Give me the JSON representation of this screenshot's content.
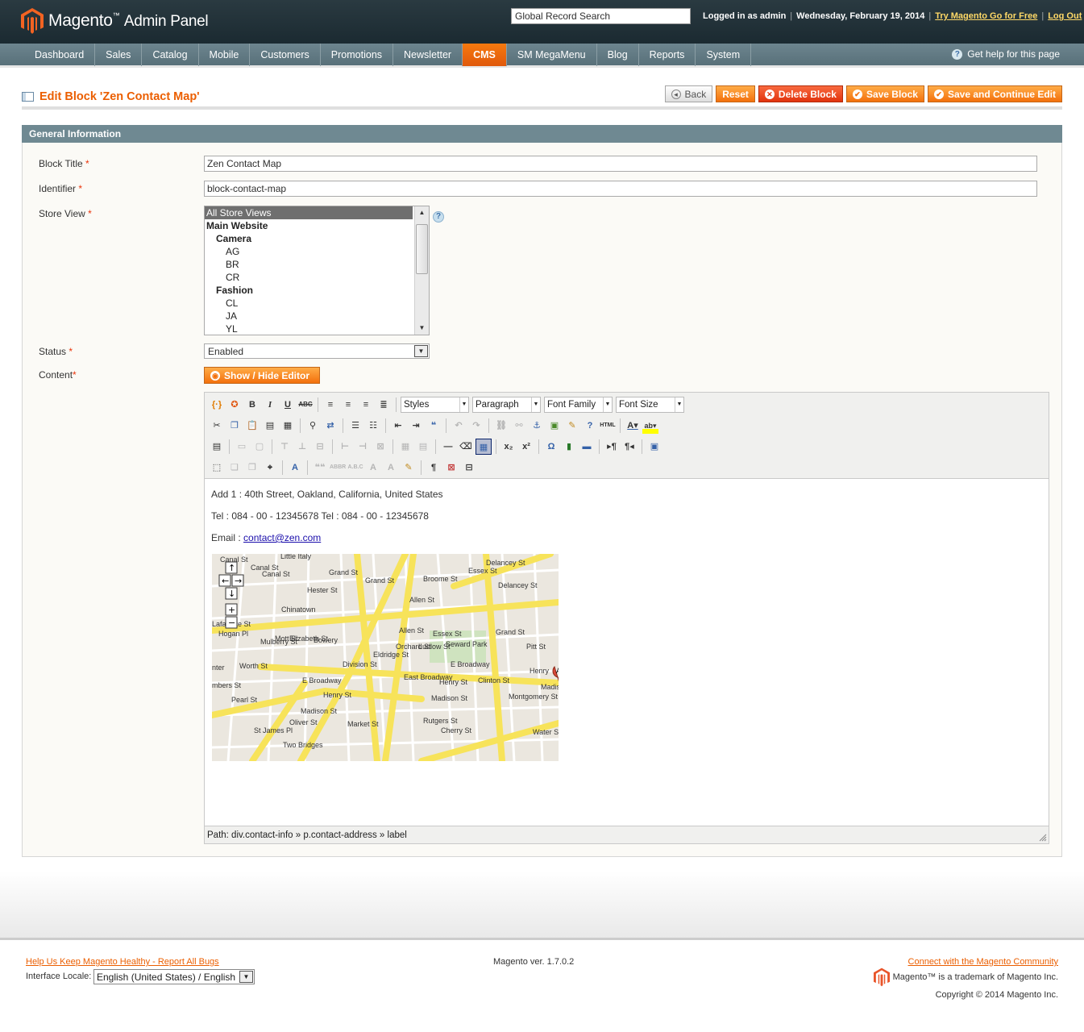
{
  "header": {
    "logo_brand": "Magento",
    "logo_tm": "™",
    "logo_product": "Admin Panel",
    "search_value": "Global Record Search",
    "logged_in": "Logged in as admin",
    "date": "Wednesday, February 19, 2014",
    "try_link": "Try Magento Go for Free",
    "logout_link": "Log Out",
    "separator": "|"
  },
  "nav": {
    "items": [
      "Dashboard",
      "Sales",
      "Catalog",
      "Mobile",
      "Customers",
      "Promotions",
      "Newsletter",
      "CMS",
      "SM MegaMenu",
      "Blog",
      "Reports",
      "System"
    ],
    "active": "CMS",
    "help": "Get help for this page",
    "help_icon_glyph": "?"
  },
  "page": {
    "title": "Edit Block 'Zen Contact Map'",
    "buttons": {
      "back": "Back",
      "reset": "Reset",
      "delete": "Delete Block",
      "save": "Save Block",
      "save_continue": "Save and Continue Edit"
    }
  },
  "form": {
    "section_title": "General Information",
    "required_mark": "*",
    "block_title_label": "Block Title",
    "block_title_value": "Zen Contact Map",
    "identifier_label": "Identifier",
    "identifier_value": "block-contact-map",
    "store_view_label": "Store View",
    "store_view_help_glyph": "?",
    "store_options": [
      {
        "label": "All Store Views",
        "kind": "sel"
      },
      {
        "label": "Main Website",
        "kind": "grp"
      },
      {
        "label": "Camera",
        "kind": "sub"
      },
      {
        "label": "AG",
        "kind": "leaf"
      },
      {
        "label": "BR",
        "kind": "leaf"
      },
      {
        "label": "CR",
        "kind": "leaf"
      },
      {
        "label": "Fashion",
        "kind": "sub"
      },
      {
        "label": "CL",
        "kind": "leaf"
      },
      {
        "label": "JA",
        "kind": "leaf"
      },
      {
        "label": "YL",
        "kind": "leaf"
      }
    ],
    "status_label": "Status",
    "status_value": "Enabled",
    "content_label": "Content",
    "toggle_editor": "Show / Hide Editor"
  },
  "editor": {
    "styles": "Styles",
    "format": "Paragraph",
    "font_family": "Font Family",
    "font_size": "Font Size",
    "line1": "Add 1 : 40th Street, Oakland, California, United States",
    "line2": "Tel : 084 - 00 - 12345678 Tel : 084 - 00 - 12345678",
    "email_prefix": "Email : ",
    "email_link": "contact@zen.com",
    "path": "Path: div.contact-info » p.contact-address » label",
    "map_labels": [
      "Little Italy",
      "Canal St",
      "Canal St",
      "Canal St",
      "Hester St",
      "Grand St",
      "Grand St",
      "Broome St",
      "Delancey St",
      "Essex St",
      "Delancey St",
      "Chinatown",
      "Bowery",
      "Mulberry St",
      "Mott St",
      "Elizabeth St",
      "Eldridge St",
      "Orchard St",
      "Ludlow St",
      "Allen St",
      "Essex St",
      "Grand St",
      "Seward Park",
      "Worth St",
      "Division St",
      "E Broadway",
      "E Broadway",
      "East Broadway",
      "Henry St",
      "Henry St",
      "Madison St",
      "Madison St",
      "Clinton St",
      "Montgomery St",
      "Pitt St",
      "Rutgers St",
      "Cherry St",
      "Water St",
      "Pearl St",
      "St James Pl",
      "Oliver St",
      "Market St",
      "Two Bridges",
      "Hogan Pl",
      "nter",
      "mbers St",
      "Lafayette St",
      "Allen St",
      "Henry",
      "Madis"
    ],
    "map_marker": "A"
  },
  "footer": {
    "report_bugs": "Help Us Keep Magento Healthy - Report All Bugs",
    "version": "Magento ver. 1.7.0.2",
    "community": "Connect with the Magento Community",
    "locale_label": "Interface Locale:",
    "locale_value": "English (United States) / English",
    "trademark": "Magento™ is a trademark of Magento Inc.",
    "copyright": "Copyright © 2014 Magento Inc."
  },
  "colors": {
    "accent_orange": "#eb5e00",
    "nav_bg": "#6d858f",
    "header_bg": "#1b2a31",
    "section_head": "#6f8992"
  }
}
